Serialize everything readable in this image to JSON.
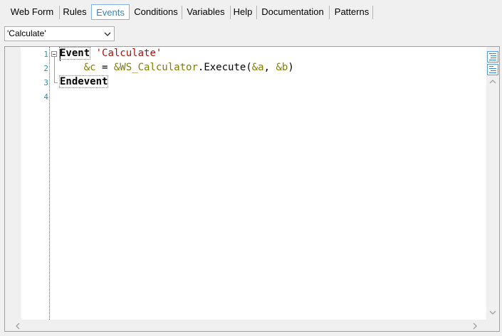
{
  "tabs": [
    {
      "label": "Web Form"
    },
    {
      "label": "Rules"
    },
    {
      "label": "Events",
      "active": true
    },
    {
      "label": "Conditions"
    },
    {
      "label": "Variables"
    },
    {
      "label": "Help"
    },
    {
      "label": "Documentation"
    },
    {
      "label": "Patterns"
    }
  ],
  "event_selector": {
    "value": "'Calculate'"
  },
  "editor": {
    "line_numbers": [
      "1",
      "2",
      "3",
      "4"
    ],
    "line1": {
      "keyword": "Event",
      "string": "'Calculate'"
    },
    "line2": {
      "var_c": "&c",
      "equals": " = ",
      "var_ws": "&WS_Calculator",
      "method": ".Execute(",
      "var_a": "&a",
      "comma": ", ",
      "var_b": "&b",
      "close": ")"
    },
    "line3": {
      "keyword": "Endevent"
    }
  },
  "colors": {
    "keyword": "#000000",
    "string": "#a31515",
    "variable": "#808000",
    "line_number": "#2b91af",
    "active_tab_text": "#2e86c8"
  },
  "icons": {
    "dropdown": "chevron-down-icon",
    "fold": "collapse-icon",
    "side1": "outline-view-icon",
    "side2": "outline-list-icon"
  }
}
